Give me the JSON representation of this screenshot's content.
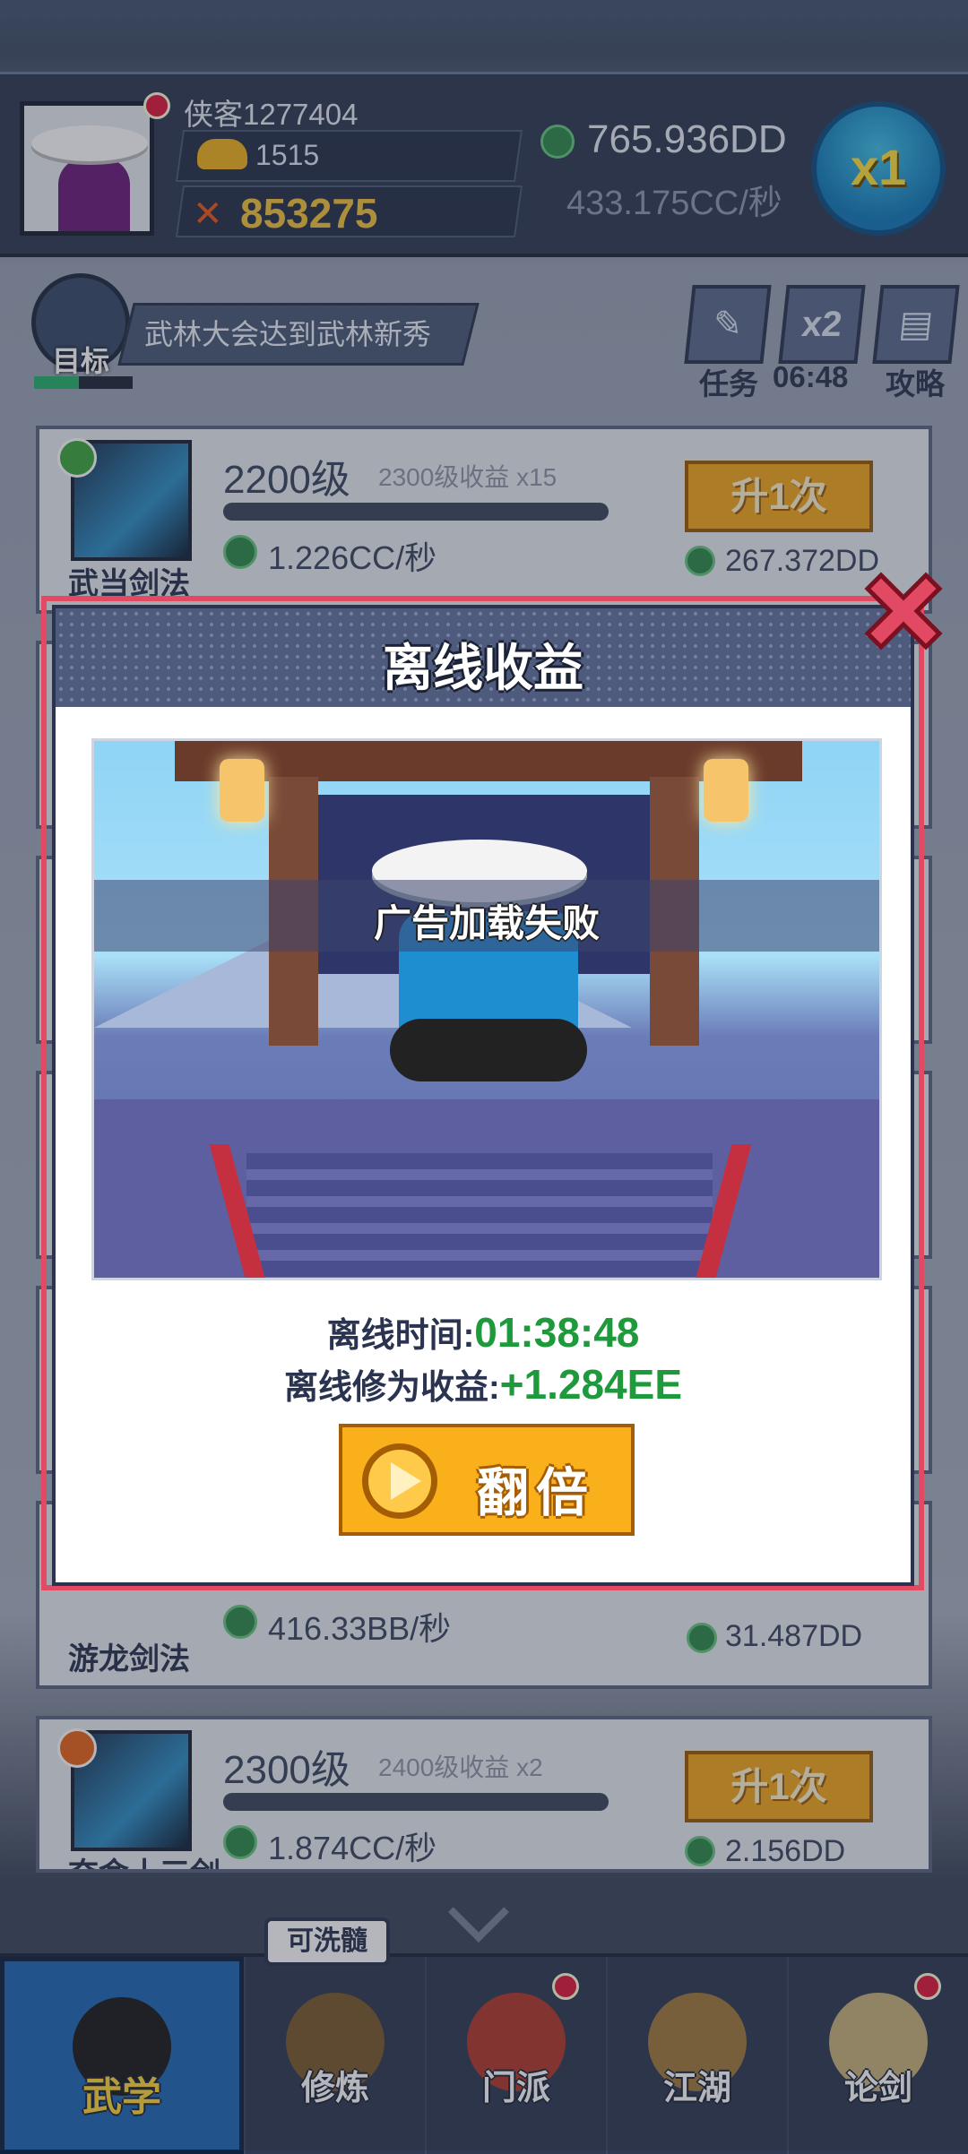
{
  "header": {
    "player_name": "侠客1277404",
    "gold": "1515",
    "power": "853275",
    "money": "765.936DD",
    "money_rate": "433.175CC/秒",
    "speed_multiplier": "x1"
  },
  "target": {
    "label": "目标",
    "text": "武林大会达到武林新秀",
    "progress": 0.45
  },
  "quick_buttons": {
    "task_label": "任务",
    "double_icon_text": "x2",
    "timer": "06:48",
    "guide_label": "攻略"
  },
  "skills": [
    {
      "name": "武当剑法",
      "level": "2200级",
      "next_bonus": "2300级收益 x15",
      "rate": "1.226CC/秒",
      "upgrade_label": "升1次",
      "cost": "267.372DD",
      "badge": "leaf"
    },
    {
      "name": "游龙剑法",
      "rate": "416.33BB/秒",
      "cost": "31.487DD"
    },
    {
      "name": "夺命十三剑",
      "level": "2300级",
      "next_bonus": "2400级收益 x2",
      "rate": "1.874CC/秒",
      "upgrade_label": "升1次",
      "cost": "2.156DD",
      "badge": "fire"
    }
  ],
  "modal": {
    "title": "离线收益",
    "ad_status": "广告加载失败",
    "offline_time_label": "离线时间:",
    "offline_time": "01:38:48",
    "offline_reward_label": "离线修为收益:",
    "offline_reward": "+1.284EE",
    "double_label": "翻倍"
  },
  "nav": {
    "bubble": "可洗髓",
    "items": [
      "武学",
      "修炼",
      "门派",
      "江湖",
      "论剑"
    ],
    "active": "武学"
  },
  "colors": {
    "accent_orange": "#f4a61c",
    "reward_green": "#1e9a3c",
    "close_red": "#e24a63",
    "power_gold": "#f5c33b"
  }
}
